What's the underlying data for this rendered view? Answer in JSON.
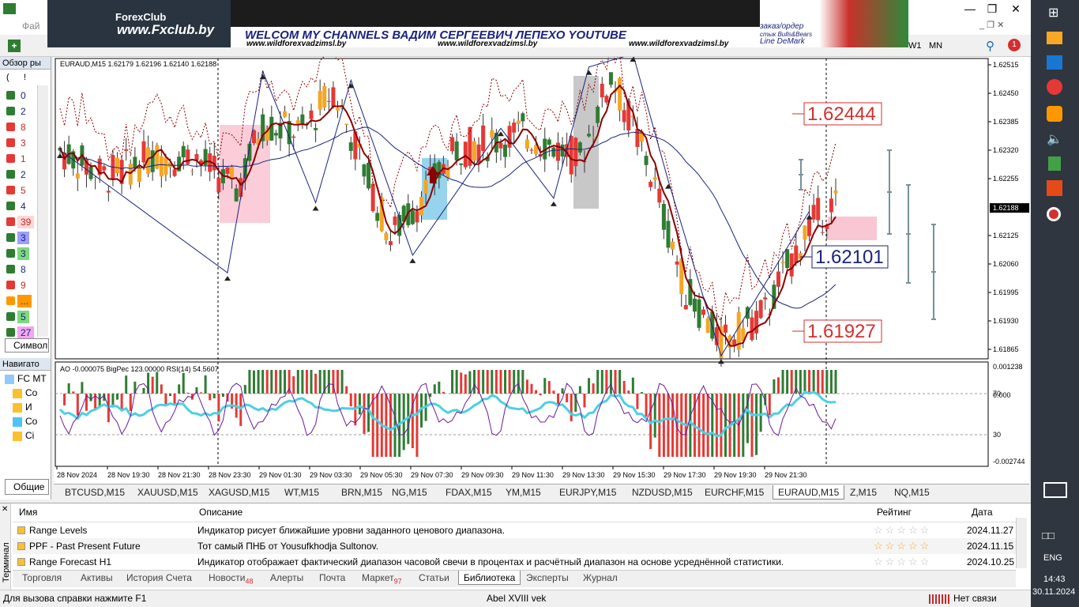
{
  "menu": {
    "file": "Фай"
  },
  "banner": {
    "site": "www.Fxclub.by",
    "brand": "ForexClub",
    "welcome": "WELCOM MY CHANNELS ВАДИМ СЕРГЕЕВИЧ ЛЕПЕХО YOUTUBE",
    "url1": "www.wildforexvadzimsl.by",
    "url2": "www.wildforexvadzimsl.by",
    "url3": "www.wildforexvadzimsl.by",
    "note1": "заказ/ордер",
    "note2": "стык Bulls&Bears",
    "note3": "Line DeMark"
  },
  "timeframes": [
    "W1",
    "MN"
  ],
  "notif_count": "1",
  "market_watch": {
    "title": "Обзор ры",
    "header_a": "(",
    "header_b": "!",
    "rows": [
      "0",
      "2",
      "8",
      "3",
      "1",
      "2",
      "5",
      "4",
      "39",
      "3",
      "3",
      "8",
      "9",
      "...",
      "5",
      "27"
    ],
    "tab": "Символ"
  },
  "navigator": {
    "title": "Навигато",
    "items": [
      "FC MT",
      "Co",
      "И",
      "Co",
      "Сi"
    ],
    "tab": "Общие"
  },
  "chart": {
    "header": "EURAUD,M15  1.62179 1.62196 1.62140 1.62188",
    "price_labels": [
      "1.62515",
      "1.62450",
      "1.62385",
      "1.62320",
      "1.62255",
      "1.62188",
      "1.62125",
      "1.62060",
      "1.61995",
      "1.61930",
      "1.61865"
    ],
    "current_price": "1.62188",
    "box_high": "1.62444",
    "box_mid": "1.62101",
    "box_low": "1.61927",
    "indicator_header": "AO -0.000075  BigPec 123.00000  RSI(14) 54.5607",
    "ind_labels": [
      "0.001238",
      "70",
      "0.000",
      "30",
      "-0.002744"
    ],
    "time_labels": [
      "28 Nov 2024",
      "28 Nov 19:30",
      "28 Nov 21:30",
      "28 Nov 23:30",
      "29 Nov 01:30",
      "29 Nov 03:30",
      "29 Nov 05:30",
      "29 Nov 07:30",
      "29 Nov 09:30",
      "29 Nov 11:30",
      "29 Nov 13:30",
      "29 Nov 15:30",
      "29 Nov 17:30",
      "29 Nov 19:30",
      "29 Nov 21:30"
    ]
  },
  "symbol_tabs": [
    "BTCUSD,M15",
    "XAUUSD,M15",
    "XAGUSD,M15",
    "WT,M15",
    "BRN,M15",
    "NG,M15",
    "FDAX,M15",
    "YM,M15",
    "EURJPY,M15",
    "NZDUSD,M15",
    "EURCHF,M15",
    "EURAUD,M15",
    "Z,M15",
    "NQ,M15"
  ],
  "active_symbol_tab": "EURAUD,M15",
  "terminal": {
    "side_label": "Терминал",
    "col_name": "Имя",
    "col_desc": "Описание",
    "col_rating": "Рейтинг",
    "col_date": "Дата",
    "rows": [
      {
        "name": "Range Levels",
        "desc": "Индикатор рисует ближайшие уровни заданного ценового диапазона.",
        "date": "2024.11.27"
      },
      {
        "name": "PPF - Past Present Future",
        "desc": "Тот самый ПНБ от Yousufkhodja Sultonov.",
        "date": "2024.11.15"
      },
      {
        "name": "Range Forecast H1",
        "desc": "Индикатор отображает фактический диапазон часовой свечи в процентах и расчётный диапазон на основе усреднённой статистики.",
        "date": "2024.10.25"
      }
    ],
    "tabs": [
      "Торговля",
      "Активы",
      "История Счета",
      "Новости",
      "Алерты",
      "Почта",
      "Маркет",
      "Статьи",
      "Библиотека",
      "Эксперты",
      "Журнал"
    ],
    "news_count": "48",
    "market_count": "97"
  },
  "status": {
    "help": "Для вызова справки нажмите F1",
    "profile": "Abel XVIII vek",
    "connection": "Нет связи"
  },
  "taskbar": {
    "lang": "ENG",
    "time": "14:43",
    "date": "30.11.2024"
  },
  "colors": {
    "bull": "#2e7d32",
    "bear": "#e53935",
    "orange": "#f5a623",
    "ma": "#8b0000",
    "slow_ma": "#1a237e",
    "rsi": "#4dd0e1"
  }
}
